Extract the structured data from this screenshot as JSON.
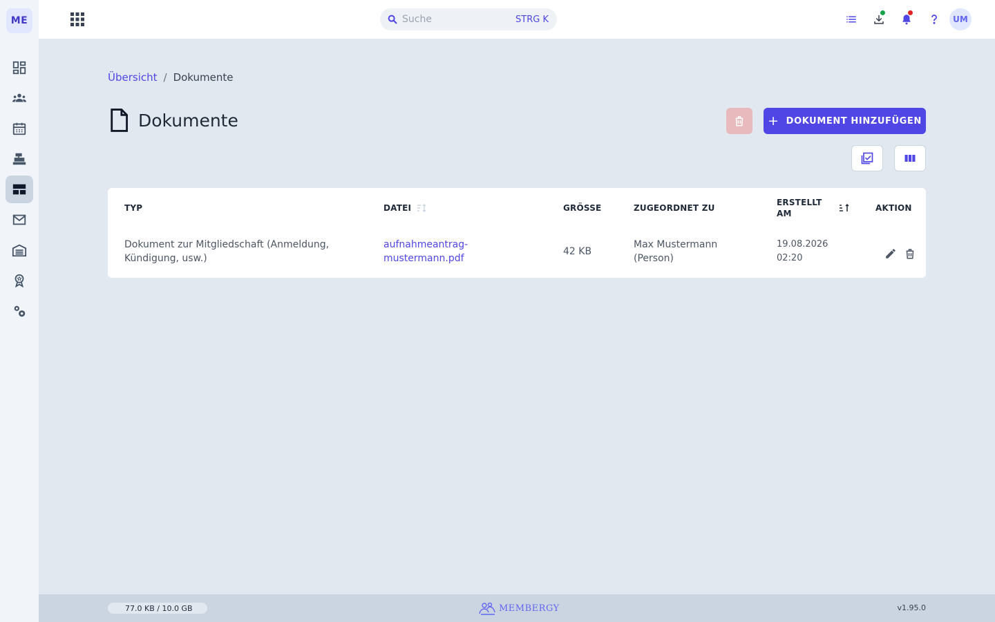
{
  "sidebar": {
    "logo": "ME",
    "items": [
      {
        "icon": "dashboard-icon"
      },
      {
        "icon": "people-icon"
      },
      {
        "icon": "calendar-icon"
      },
      {
        "icon": "cash-register-icon"
      },
      {
        "icon": "table-view-icon",
        "active": true
      },
      {
        "icon": "mail-icon"
      },
      {
        "icon": "warehouse-icon"
      },
      {
        "icon": "award-icon"
      },
      {
        "icon": "settings-icon"
      }
    ]
  },
  "topbar": {
    "search": {
      "placeholder": "Suche",
      "shortcut": "STRG K"
    },
    "avatar": "UM",
    "icons": [
      "list-icon",
      "download-icon",
      "bell-icon",
      "help-icon"
    ],
    "status_colors": {
      "download_dot": "#16a34a",
      "bell_dot": "#dc2626"
    }
  },
  "breadcrumb": {
    "parent": "Übersicht",
    "separator": "/",
    "current": "Dokumente"
  },
  "page": {
    "title": "Dokumente",
    "add_button": "DOKUMENT HINZUFÜGEN"
  },
  "table": {
    "headers": {
      "typ": "TYP",
      "datei": "DATEI",
      "groesse": "GRÖSSE",
      "zugeordnet": "ZUGEORDNET ZU",
      "erstellt_line1": "ERSTELLT",
      "erstellt_line2": "AM",
      "aktion": "AKTION"
    },
    "rows": [
      {
        "typ_line1": "Dokument zur Mitgliedschaft (Anmeldung,",
        "typ_line2": "Kündigung, usw.)",
        "datei_line1": "aufnahmeantrag-",
        "datei_line2": "mustermann.pdf",
        "groesse": "42 KB",
        "zugeordnet_line1": "Max Mustermann",
        "zugeordnet_line2": "(Person)",
        "erstellt_date": "19.08.2026",
        "erstellt_time": "02:20"
      }
    ]
  },
  "footer": {
    "storage": "77.0 KB / 10.0 GB",
    "brand": "MEMBERGY",
    "version": "v1.95.0"
  },
  "colors": {
    "accent": "#4f46e5",
    "delete_disabled": "#e8b9bd",
    "background": "#e2e8f0"
  }
}
